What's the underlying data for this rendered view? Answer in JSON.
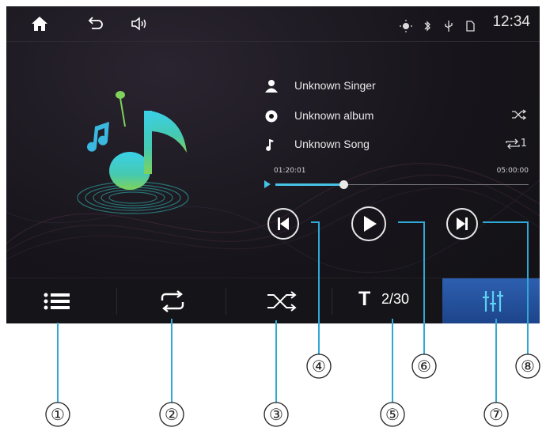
{
  "status_bar": {
    "icons": [
      "home-icon",
      "back-icon",
      "volume-icon"
    ],
    "indicators": [
      "brightness-icon",
      "bluetooth-icon",
      "usb-icon",
      "sd-card-icon"
    ],
    "clock": "12:34"
  },
  "track": {
    "singer": "Unknown Singer",
    "album": "Unknown album",
    "song": "Unknown Song",
    "repeat_indicator": "1",
    "elapsed": "01:20:01",
    "total": "05:00:00",
    "progress_fraction": 0.27
  },
  "colors": {
    "accent": "#47c3e6",
    "eq_button": "#2d5fb0",
    "text": "#e8e8e8",
    "background": "#17151b"
  },
  "controls": [
    "previous-track-button",
    "play-button",
    "next-track-button"
  ],
  "bottom_bar": {
    "track_prefix": "T",
    "track_count": "2/30",
    "buttons": [
      "playlist-icon",
      "repeat-icon",
      "shuffle-icon",
      "track-indicator",
      "equalizer-icon"
    ]
  },
  "callouts": [
    "①",
    "②",
    "③",
    "④",
    "⑤",
    "⑥",
    "⑦",
    "⑧"
  ]
}
